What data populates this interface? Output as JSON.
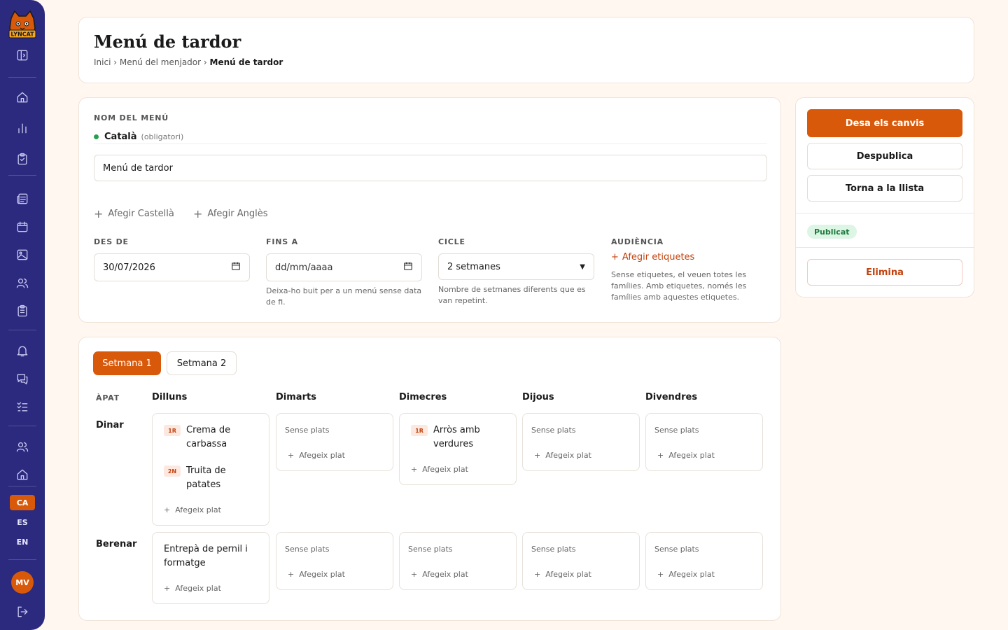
{
  "sidebar": {
    "logo_text": "LYNCAT",
    "toggle_icon": "sidebar-toggle-icon",
    "nav_icons": [
      "home-icon",
      "chart-icon",
      "clipboard-check-icon",
      "newspaper-icon",
      "calendar-icon",
      "image-icon",
      "users-icon",
      "clipboard-list-icon",
      "bell-icon",
      "chat-icon",
      "list-check-icon",
      "user-group-icon",
      "house-icon"
    ],
    "languages": [
      "CA",
      "ES",
      "EN"
    ],
    "active_language": "CA",
    "avatar_initials": "MV",
    "logout_icon": "logout-icon"
  },
  "header": {
    "title": "Menú de tardor",
    "breadcrumb": [
      "Inici",
      "Menú del menjador",
      "Menú de tardor"
    ],
    "separator": "›"
  },
  "form": {
    "name_label": "NOM DEL MENÚ",
    "language_name": "Català",
    "language_required": "(obligatori)",
    "name_value": "Menú de tardor",
    "add_languages": [
      "Afegir Castellà",
      "Afegir Anglès"
    ],
    "from": {
      "label": "DES DE",
      "value": "30/07/2026"
    },
    "to": {
      "label": "FINS A",
      "placeholder": "dd/mm/aaaa",
      "help": "Deixa-ho buit per a un menú sense data de fi."
    },
    "cycle": {
      "label": "CICLE",
      "value": "2 setmanes",
      "help": "Nombre de setmanes diferents que es van repetint."
    },
    "audience": {
      "label": "AUDIÈNCIA",
      "add_tags": "Afegir etiquetes",
      "help": "Sense etiquetes, el veuen totes les famílies. Amb etiquetes, només les famílies amb aquestes etiquetes."
    }
  },
  "week": {
    "tabs": [
      "Setmana 1",
      "Setmana 2"
    ],
    "active_tab": 0,
    "meal_header": "ÀPAT",
    "days": [
      "Dilluns",
      "Dimarts",
      "Dimecres",
      "Dijous",
      "Divendres"
    ],
    "empty_label": "Sense plats",
    "add_dish_label": "Afegeix plat",
    "meals": [
      {
        "name": "Dinar",
        "slots": [
          {
            "dishes": [
              {
                "tag": "1R",
                "line1": "Crema de",
                "line2": "carbassa"
              },
              {
                "tag": "2N",
                "line1": "Truita de",
                "line2": "patates"
              }
            ]
          },
          {
            "dishes": []
          },
          {
            "dishes": [
              {
                "tag": "1R",
                "line1": "Arròs amb",
                "line2": "verdures"
              }
            ]
          },
          {
            "dishes": []
          },
          {
            "dishes": []
          }
        ]
      },
      {
        "name": "Berenar",
        "slots": [
          {
            "dishes": [
              {
                "tag": "",
                "line1": "Entrepà de pernil i",
                "line2": "formatge"
              }
            ]
          },
          {
            "dishes": []
          },
          {
            "dishes": []
          },
          {
            "dishes": []
          },
          {
            "dishes": []
          }
        ]
      }
    ]
  },
  "actions": {
    "save": "Desa els canvis",
    "unpublish": "Despublica",
    "back": "Torna a la llista",
    "status": "Publicat",
    "delete": "Elimina"
  },
  "colors": {
    "sidebar": "#2b2a7e",
    "accent": "#d9590b",
    "background": "#fff7f0",
    "published_bg": "#dcf5e4",
    "published_text": "#1c7a3c"
  }
}
